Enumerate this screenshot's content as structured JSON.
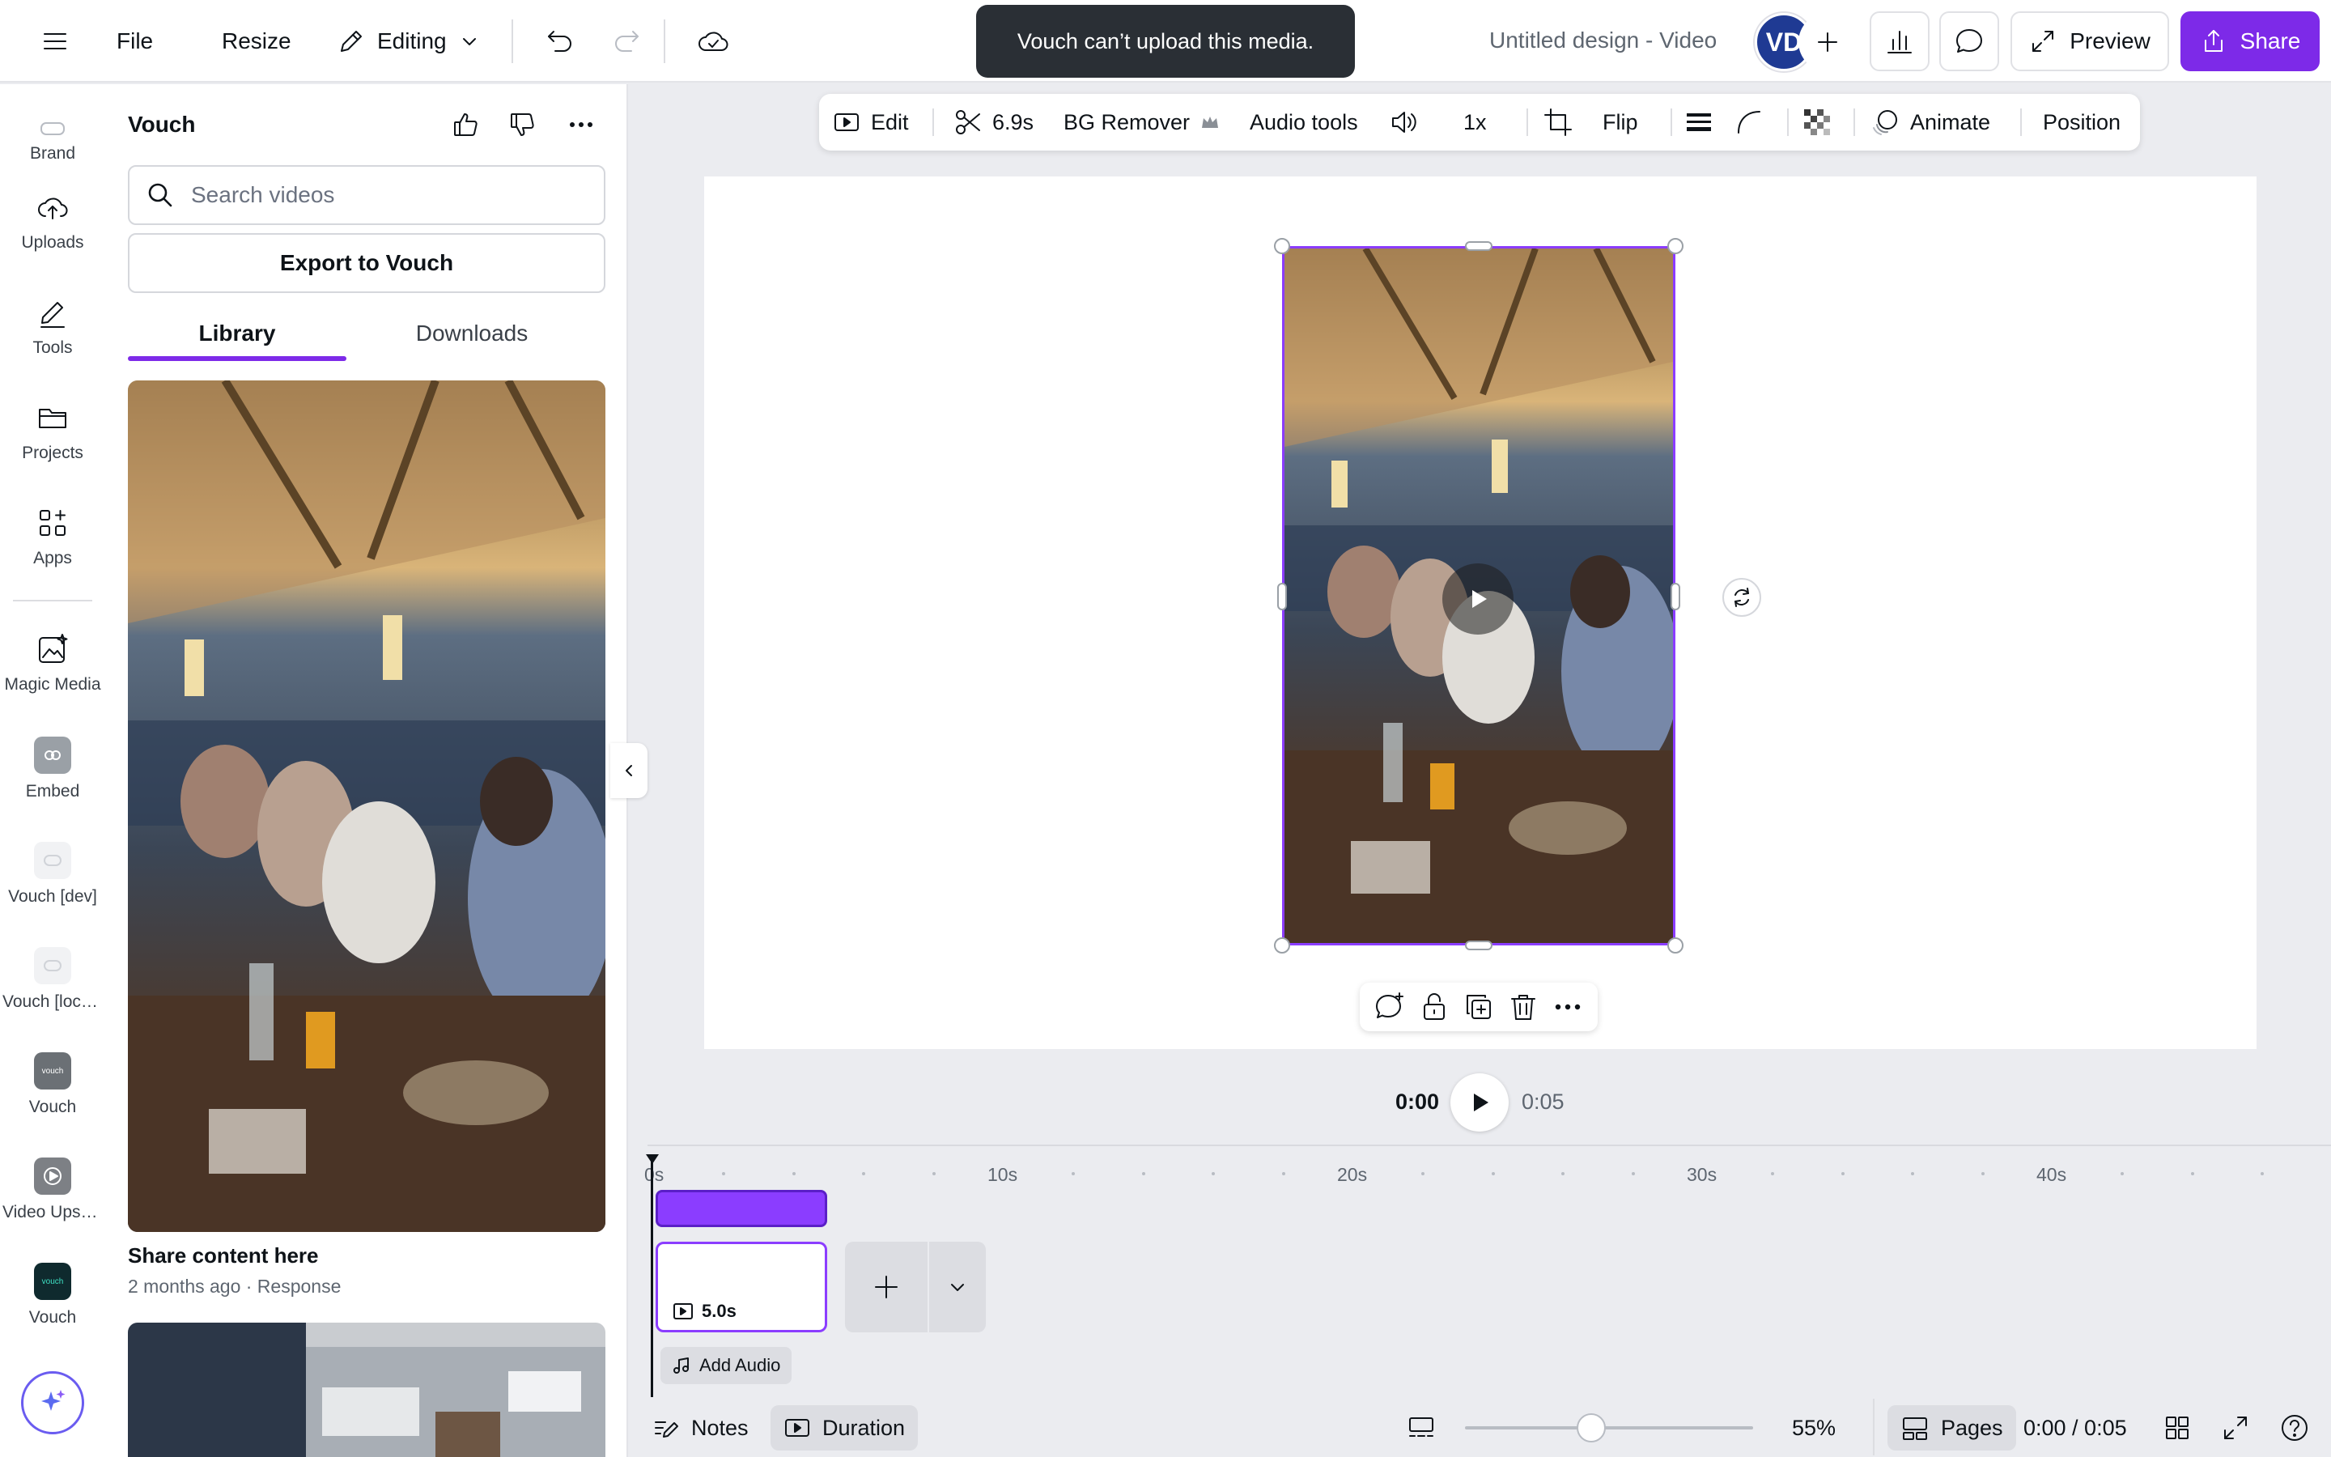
{
  "topbar": {
    "file": "File",
    "resize": "Resize",
    "editing": "Editing",
    "title": "Untitled design - Video",
    "avatar_initials": "VD",
    "preview": "Preview",
    "share": "Share"
  },
  "toast": {
    "message": "Vouch can’t upload this media."
  },
  "rail": {
    "items": [
      {
        "label": "Brand",
        "icon": "brand-icon"
      },
      {
        "label": "Uploads",
        "icon": "cloud-upload-icon"
      },
      {
        "label": "Tools",
        "icon": "pen-icon"
      },
      {
        "label": "Projects",
        "icon": "folder-icon"
      },
      {
        "label": "Apps",
        "icon": "apps-grid-icon"
      },
      {
        "label": "Magic Media",
        "icon": "magic-media-icon"
      },
      {
        "label": "Embed",
        "icon": "embed-icon"
      },
      {
        "label": "Vouch [dev]",
        "icon": "vouch-dev-icon"
      },
      {
        "label": "Vouch [loca...",
        "icon": "vouch-local-icon"
      },
      {
        "label": "Vouch",
        "icon": "vouch-icon"
      },
      {
        "label": "Video Upsc...",
        "icon": "video-upscale-icon"
      },
      {
        "label": "Vouch",
        "icon": "vouch-app-icon"
      }
    ],
    "app_badge_text": "vouch"
  },
  "panel": {
    "title": "Vouch",
    "search_placeholder": "Search videos",
    "export_button": "Export to Vouch",
    "tabs": [
      {
        "label": "Library",
        "active": true
      },
      {
        "label": "Downloads",
        "active": false
      }
    ],
    "cards": [
      {
        "title": "Share content here",
        "meta": "2 months ago · Response"
      }
    ]
  },
  "context_toolbar": {
    "edit": "Edit",
    "trim_duration": "6.9s",
    "bg_remover": "BG Remover",
    "audio_tools": "Audio tools",
    "speed": "1x",
    "flip": "Flip",
    "animate": "Animate",
    "position": "Position"
  },
  "playback": {
    "current": "0:00",
    "total": "0:05"
  },
  "timeline": {
    "ruler": [
      "0s",
      "10s",
      "20s",
      "30s",
      "40s"
    ],
    "clip_duration": "5.0s",
    "add_audio": "Add Audio"
  },
  "bottombar": {
    "notes": "Notes",
    "duration": "Duration",
    "zoom": "55%",
    "pages": "Pages",
    "time": "0:00 / 0:05"
  },
  "colors": {
    "accent": "#7d2ae8",
    "selection": "#8b3dff",
    "avatar": "#1f3a93",
    "toast_bg": "#2a2f35"
  }
}
